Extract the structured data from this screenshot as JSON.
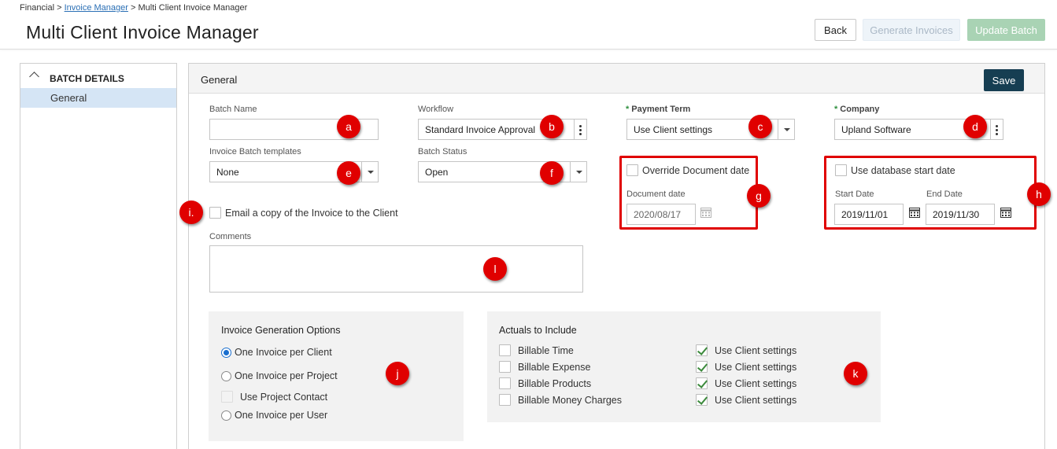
{
  "breadcrumb": {
    "root": "Financial",
    "sep1": ">",
    "link": "Invoice Manager",
    "sep2": ">",
    "current": "Multi Client Invoice Manager"
  },
  "page": {
    "title": "Multi Client Invoice Manager"
  },
  "header_buttons": {
    "back": "Back",
    "generate": "Generate Invoices",
    "update": "Update Batch"
  },
  "sidebar": {
    "heading": "BATCH DETAILS",
    "items": [
      {
        "label": "General",
        "selected": true
      }
    ]
  },
  "panel": {
    "title": "General",
    "save": "Save"
  },
  "form": {
    "batch_name": {
      "label": "Batch Name",
      "value": ""
    },
    "workflow": {
      "label": "Workflow",
      "value": "Standard Invoice Approval"
    },
    "payment_term": {
      "required_mark": "*",
      "label": "Payment Term",
      "value": "Use Client settings"
    },
    "company": {
      "required_mark": "*",
      "label": "Company",
      "value": "Upland Software"
    },
    "templates": {
      "label": "Invoice Batch templates",
      "value": "None"
    },
    "batch_status": {
      "label": "Batch Status",
      "value": "Open"
    },
    "override_doc_date": {
      "label": "Override Document date",
      "checked": false
    },
    "document_date": {
      "label": "Document date",
      "value": "2020/08/17"
    },
    "use_db_start": {
      "label": "Use database start date",
      "checked": false
    },
    "start_date": {
      "label": "Start Date",
      "value": "2019/11/01"
    },
    "end_date": {
      "label": "End Date",
      "value": "2019/11/30"
    },
    "email_copy": {
      "label": "Email a copy of the Invoice to the Client",
      "checked": false
    },
    "comments": {
      "label": "Comments",
      "value": ""
    }
  },
  "generation": {
    "title": "Invoice Generation Options",
    "options": [
      {
        "label": "One Invoice per Client",
        "selected": true
      },
      {
        "label": "One Invoice per Project",
        "selected": false
      },
      {
        "label": "One Invoice per User",
        "selected": false
      }
    ],
    "use_project_contact": {
      "label": "Use Project Contact",
      "checked": false,
      "disabled": true
    }
  },
  "actuals": {
    "title": "Actuals to Include",
    "rows": [
      {
        "label": "Billable Time",
        "checked": false,
        "setting": "Use Client settings",
        "setting_checked": true
      },
      {
        "label": "Billable Expense",
        "checked": false,
        "setting": "Use Client settings",
        "setting_checked": true
      },
      {
        "label": "Billable Products",
        "checked": false,
        "setting": "Use Client settings",
        "setting_checked": true
      },
      {
        "label": "Billable Money Charges",
        "checked": false,
        "setting": "Use Client settings",
        "setting_checked": true
      }
    ]
  },
  "annotations": {
    "a": "a",
    "b": "b",
    "c": "c",
    "d": "d",
    "e": "e",
    "f": "f",
    "g": "g",
    "h": "h",
    "i": "i.",
    "j": "j",
    "k": "k",
    "l": "l"
  },
  "colors": {
    "marker": "#e00000",
    "save_bg": "#163e52",
    "update_bg": "#a9d3b4",
    "sidebar_selected": "#d5e5f5",
    "link": "#2a6fb5",
    "required": "#2f8f3e"
  }
}
